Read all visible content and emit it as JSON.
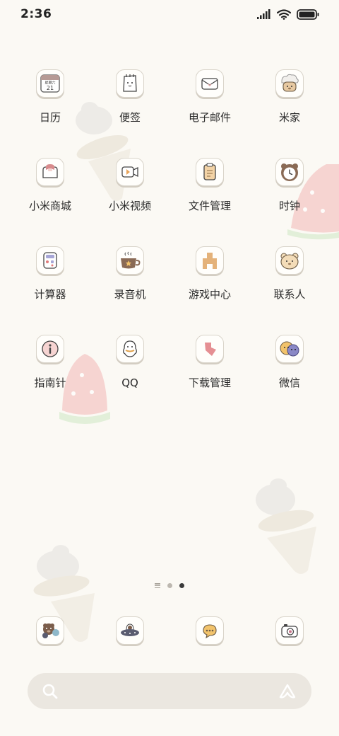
{
  "status_bar": {
    "time": "2:36",
    "icons": [
      "signal-icon",
      "wifi-icon",
      "battery-icon"
    ]
  },
  "apps": [
    {
      "label": "日历",
      "icon": "calendar-icon",
      "calendar_weekday": "星期六",
      "calendar_day": "21"
    },
    {
      "label": "便签",
      "icon": "notes-icon"
    },
    {
      "label": "电子邮件",
      "icon": "email-icon"
    },
    {
      "label": "米家",
      "icon": "mijia-icon"
    },
    {
      "label": "小米商城",
      "icon": "mi-store-icon"
    },
    {
      "label": "小米视频",
      "icon": "mi-video-icon"
    },
    {
      "label": "文件管理",
      "icon": "file-manager-icon"
    },
    {
      "label": "时钟",
      "icon": "clock-icon"
    },
    {
      "label": "计算器",
      "icon": "calculator-icon"
    },
    {
      "label": "录音机",
      "icon": "recorder-icon"
    },
    {
      "label": "游戏中心",
      "icon": "game-center-icon"
    },
    {
      "label": "联系人",
      "icon": "contacts-icon"
    },
    {
      "label": "指南针",
      "icon": "compass-icon"
    },
    {
      "label": "QQ",
      "icon": "qq-icon"
    },
    {
      "label": "下载管理",
      "icon": "download-manager-icon"
    },
    {
      "label": "微信",
      "icon": "wechat-icon"
    }
  ],
  "page_indicator": {
    "pages": 3,
    "active": 2
  },
  "dock": [
    {
      "icon": "phone-bear-icon"
    },
    {
      "icon": "browser-ufo-icon"
    },
    {
      "icon": "messages-icon"
    },
    {
      "icon": "camera-icon"
    }
  ],
  "search_bar": {
    "icons": [
      "search-icon",
      "assistant-icon"
    ]
  },
  "colors": {
    "background": "#fbf9f4",
    "icon_outline": "#d9d4ca",
    "search_bg": "#ebe7e0",
    "active_dot": "#3a3a3a"
  }
}
